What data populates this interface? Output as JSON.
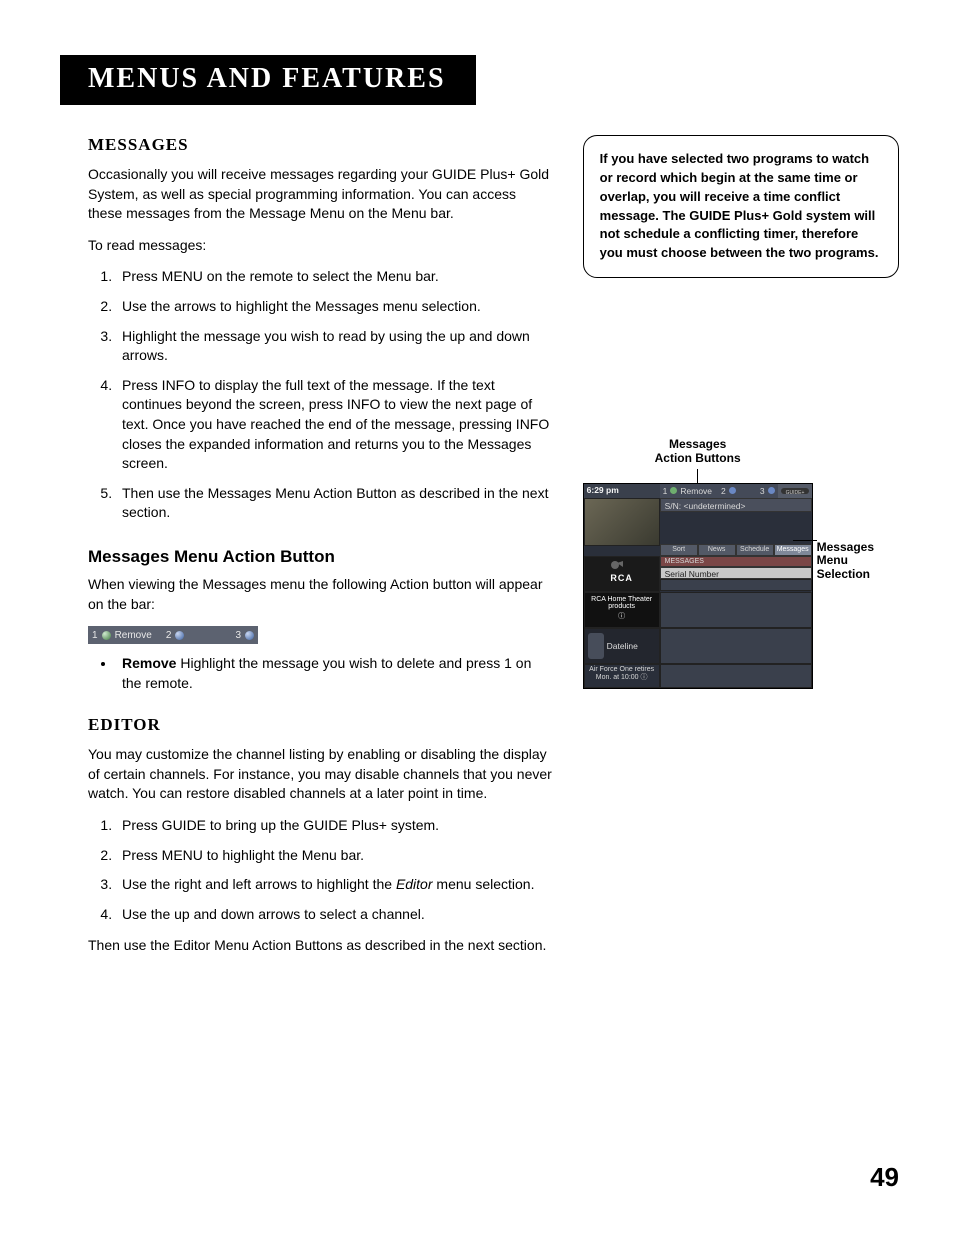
{
  "page_title": "Menus and Features",
  "page_number": "49",
  "messages": {
    "heading": "Messages",
    "intro": "Occasionally you will receive messages regarding your GUIDE Plus+ Gold System, as well as special programming information. You can access these messages from the Message Menu on the Menu bar.",
    "to_read": "To read messages:",
    "steps": [
      "Press MENU on the remote to select the Menu bar.",
      "Use the arrows to highlight the Messages menu selection.",
      "Highlight the message you wish to read by using the up and down arrows.",
      "Press INFO to display the full text of the message. If the text continues beyond the screen, press INFO to view the next page of text. Once you have reached the end of the message, pressing INFO closes the expanded information and returns you to the Messages screen.",
      "Then use the Messages Menu Action Button as described in the next section."
    ]
  },
  "action_button": {
    "heading": "Messages Menu Action Button",
    "intro": "When viewing the Messages menu the following Action button will appear on the bar:",
    "bar": {
      "one": "1",
      "remove": "Remove",
      "two": "2",
      "three": "3"
    },
    "bullet_strong": "Remove",
    "bullet_text": "   Highlight the message you wish to delete and press 1 on the remote."
  },
  "editor": {
    "heading": "Editor",
    "intro": "You may customize the channel listing by enabling or disabling the display of certain channels. For instance, you may disable channels that you never watch. You can restore disabled channels at a later point in time.",
    "steps_pre": [
      "Press GUIDE to bring up the GUIDE Plus+ system.",
      "Press MENU to highlight the Menu bar."
    ],
    "step3_a": "Use the right and left arrows to highlight the ",
    "step3_em": "Editor",
    "step3_b": " menu selection.",
    "step4": "Use the up and down arrows to select a channel.",
    "outro": "Then use the Editor Menu Action Buttons as described in the next section."
  },
  "note": "If you have selected two programs to watch or record which begin at the same time or overlap, you will receive a time conflict message.  The GUIDE Plus+ Gold system will not schedule a conflicting timer, therefore you must choose between the two programs.",
  "figure": {
    "label_top": "Messages\nAction Buttons",
    "callout_right": "Messages Menu Selection",
    "screen": {
      "time": "6:29 pm",
      "bar_one": "1",
      "bar_remove": "Remove",
      "bar_two": "2",
      "bar_three": "3",
      "sn_line": "S/N: <undetermined>",
      "tabs": [
        "Sort",
        "News",
        "Schedule",
        "Messages"
      ],
      "messages_label": "MESSAGES",
      "field": "Serial Number",
      "ad1_brand": "RCA",
      "ad1_line": "RCA Home Theater products",
      "ad2_text": "Dateline",
      "promo": "Air Force One retires Mon. at 10:00"
    }
  }
}
